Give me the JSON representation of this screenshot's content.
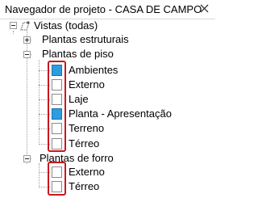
{
  "window": {
    "title": "Navegador de projeto - CASA DE CAMPO"
  },
  "colors": {
    "highlight": "#c8171e",
    "view_icon_active": "#2f9ce0",
    "tree_line": "#a0a0a0"
  },
  "tree": {
    "root": {
      "label": "Vistas (todas)",
      "icon": "views-icon",
      "expanded": true
    },
    "structural": {
      "label": "Plantas estruturais",
      "expanded": false
    },
    "floor": {
      "label": "Plantas de piso",
      "expanded": true,
      "items": [
        {
          "label": "Ambientes",
          "icon_active": true
        },
        {
          "label": "Externo",
          "icon_active": false
        },
        {
          "label": "Laje",
          "icon_active": false
        },
        {
          "label": "Planta - Apresentação",
          "icon_active": true
        },
        {
          "label": "Terreno",
          "icon_active": false
        },
        {
          "label": "Térreo",
          "icon_active": false
        }
      ]
    },
    "ceiling": {
      "label": "Plantas de forro",
      "expanded": true,
      "items": [
        {
          "label": "Externo",
          "icon_active": false
        },
        {
          "label": "Térreo",
          "icon_active": false
        }
      ]
    }
  }
}
